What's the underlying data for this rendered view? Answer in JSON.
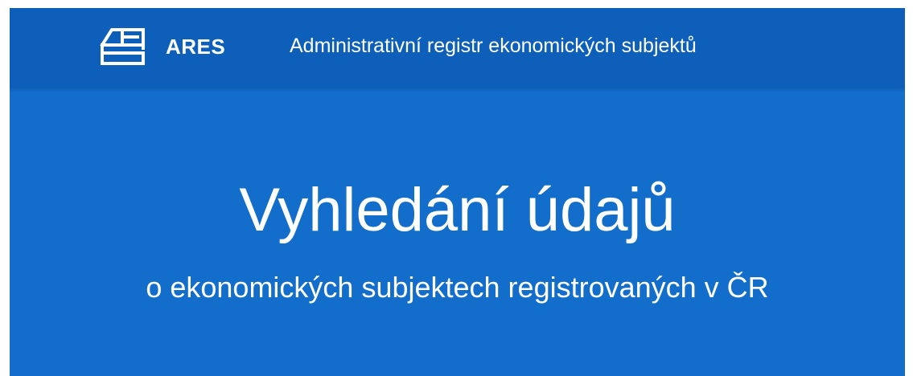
{
  "header": {
    "logo_icon": "ares-logo-icon",
    "brand": "ARES",
    "subtitle": "Administrativní registr ekonomických subjektů"
  },
  "hero": {
    "title": "Vyhledání údajů",
    "subtitle": "o ekonomických subjektech registrovaných v ČR"
  },
  "colors": {
    "header_bg": "#0d5fb9",
    "hero_bg": "#136dcb",
    "text": "#ffffff"
  }
}
